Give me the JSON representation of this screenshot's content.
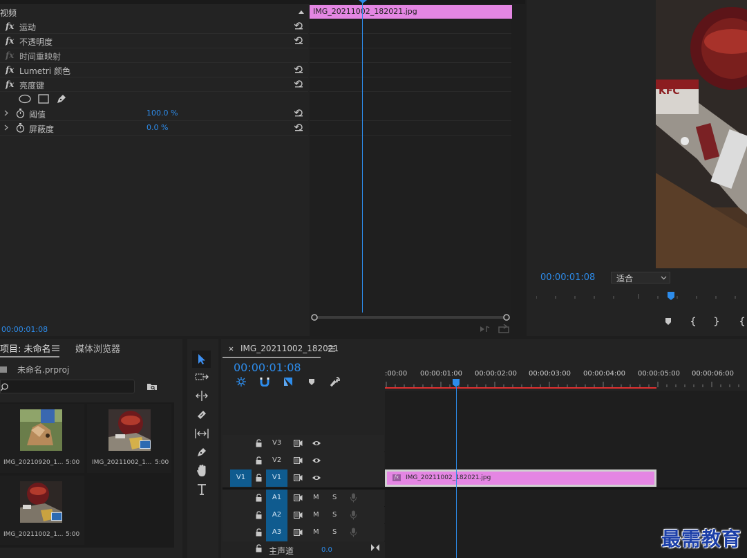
{
  "effects": {
    "section_label": "视频",
    "items": [
      {
        "label": "运动"
      },
      {
        "label": "不透明度"
      },
      {
        "label": "时间重映射"
      },
      {
        "label": "Lumetri 颜色"
      },
      {
        "label": "亮度键"
      }
    ],
    "params": [
      {
        "label": "阈值",
        "value": "100.0 %"
      },
      {
        "label": "屏蔽度",
        "value": "0.0 %"
      }
    ],
    "fx_glyph": "fx",
    "clip_name": "IMG_20211002_182021.jpg",
    "timecode": "00:00:01:08"
  },
  "monitor": {
    "timecode": "00:00:01:08",
    "fit_label": "适合"
  },
  "project": {
    "tab_project": "项目: 未命名",
    "tab_media_browser": "媒体浏览器",
    "project_file": "未命名.prproj",
    "search_placeholder": "",
    "items": [
      {
        "name": "IMG_20210920_1...",
        "duration": "5:00"
      },
      {
        "name": "IMG_20211002_1...",
        "duration": "5:00"
      },
      {
        "name": "IMG_20211002_1...",
        "duration": "5:00"
      }
    ]
  },
  "timeline": {
    "sequence_name": "IMG_20211002_182021",
    "timecode": "00:00:01:08",
    "ruler": [
      ":00:00",
      "00:00:01:00",
      "00:00:02:00",
      "00:00:03:00",
      "00:00:04:00",
      "00:00:05:00",
      "00:00:06:00"
    ],
    "tracks": {
      "v3": "V3",
      "v2": "V2",
      "v1": "V1",
      "v1_source": "V1",
      "a1": "A1",
      "a2": "A2",
      "a3": "A3"
    },
    "mute": "M",
    "solo": "S",
    "clip_name": "IMG_20211002_182021.jpg",
    "master_label": "主声道",
    "master_value": "0.0"
  },
  "watermark": "最需教育"
}
